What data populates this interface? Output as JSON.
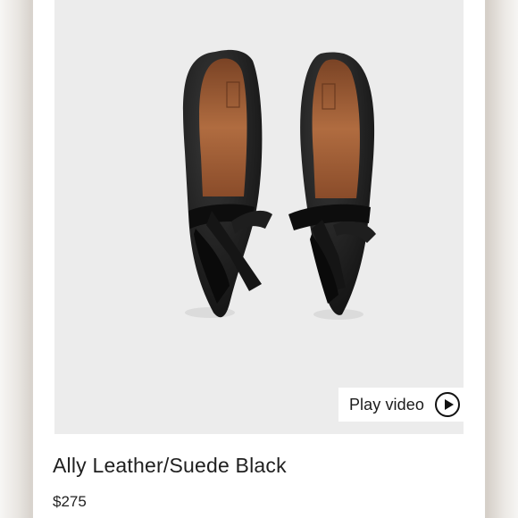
{
  "product": {
    "title": "Ally Leather/Suede Black",
    "price": "$275"
  },
  "media": {
    "play_label": "Play video",
    "play_icon": "play-circle-icon"
  },
  "colors": {
    "shoe": "#1a1a1a",
    "lining": "#a0603a",
    "photo_bg": "#ececec"
  }
}
